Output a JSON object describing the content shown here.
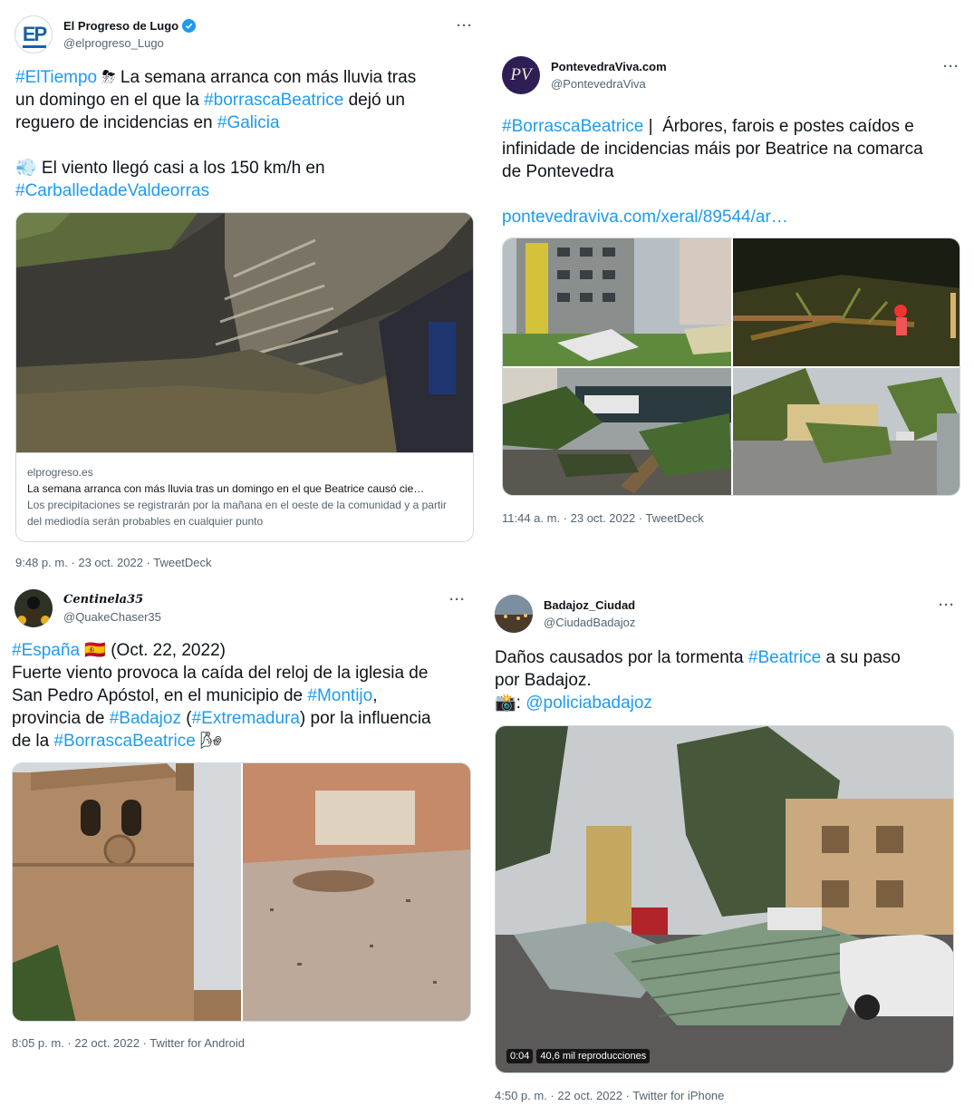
{
  "tweets": [
    {
      "display_name": "El Progreso de Lugo",
      "handle": "@elprogreso_Lugo",
      "avatar_text": "EP",
      "text_parts": [
        {
          "t": "#ElTiempo",
          "k": "tag"
        },
        {
          "t": " ⛈ La semana arranca con más lluvia tras\nun domingo en el que la ",
          "k": "plain"
        },
        {
          "t": "#borrascaBeatrice",
          "k": "tag"
        },
        {
          "t": " dejó un\nreguero de incidencias en ",
          "k": "plain"
        },
        {
          "t": "#Galicia",
          "k": "tag"
        },
        {
          "t": "\n\n💨 El viento llegó casi a los 150 km/h en\n",
          "k": "plain"
        },
        {
          "t": "#CarballedadeValdeorras",
          "k": "tag"
        }
      ],
      "card": {
        "domain": "elprogreso.es",
        "title": "La semana arranca con más lluvia tras un domingo en el que Beatrice causó cie…",
        "description": "Los precipitaciones se registrarán por la mañana en el oeste de la comunidad y a partir del mediodía serán probables en cualquier punto"
      },
      "timestamp": "9:48 p. m. · 23 oct. 2022 · TweetDeck"
    },
    {
      "display_name": "PontevedraViva.com",
      "handle": "@PontevedraViva",
      "avatar_text": "PV",
      "text_parts": [
        {
          "t": "#BorrascaBeatrice",
          "k": "tag"
        },
        {
          "t": " |  Árbores, farois e postes caídos e\ninfinidade de incidencias máis por Beatrice na comarca\nde Pontevedra\n\n",
          "k": "plain"
        },
        {
          "t": "pontevedraviva.com/xeral/89544/ar…",
          "k": "tag"
        }
      ],
      "timestamp": "11:44 a. m. · 23 oct. 2022 · TweetDeck"
    },
    {
      "display_name": "Centinela35",
      "handle": "@QuakeChaser35",
      "text_parts": [
        {
          "t": "#España",
          "k": "tag"
        },
        {
          "t": " 🇪🇸 (Oct. 22, 2022)\nFuerte viento provoca la caída del reloj de la iglesia de\nSan Pedro Apóstol, en el municipio de ",
          "k": "plain"
        },
        {
          "t": "#Montijo",
          "k": "tag"
        },
        {
          "t": ",\nprovincia de ",
          "k": "plain"
        },
        {
          "t": "#Badajoz",
          "k": "tag"
        },
        {
          "t": " (",
          "k": "plain"
        },
        {
          "t": "#Extremadura",
          "k": "tag"
        },
        {
          "t": ") por la influencia\nde la ",
          "k": "plain"
        },
        {
          "t": "#BorrascaBeatrice",
          "k": "tag"
        },
        {
          "t": " 🌬",
          "k": "plain"
        }
      ],
      "timestamp": "8:05 p. m. · 22 oct. 2022 · Twitter for Android"
    },
    {
      "display_name": "Badajoz_Ciudad",
      "handle": "@CiudadBadajoz",
      "text_parts": [
        {
          "t": "Daños causados por la tormenta ",
          "k": "plain"
        },
        {
          "t": "#Beatrice",
          "k": "tag"
        },
        {
          "t": " a su paso\npor Badajoz.\n📸: ",
          "k": "plain"
        },
        {
          "t": "@policiabadajoz",
          "k": "tag"
        }
      ],
      "video": {
        "duration": "0:04",
        "views": "40,6 mil reproducciones"
      },
      "timestamp": "4:50 p. m. · 22 oct. 2022 · Twitter for iPhone"
    }
  ],
  "more_label": "···",
  "colors": {
    "link": "#1d9bf0",
    "muted": "#536471",
    "text": "#0f1419",
    "border": "#cfd9de"
  }
}
